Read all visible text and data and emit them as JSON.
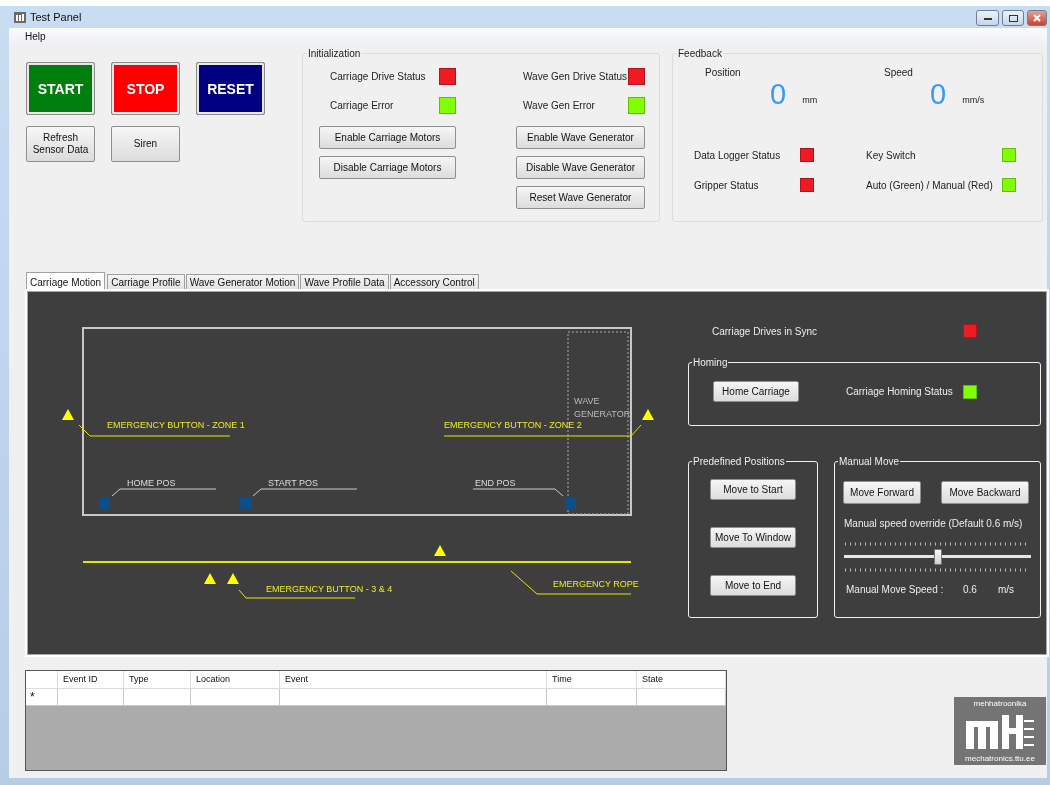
{
  "window": {
    "title": "Test Panel"
  },
  "menu": [
    "Help"
  ],
  "main_buttons": [
    {
      "label": "START",
      "color": "#007f0e"
    },
    {
      "label": "STOP",
      "color": "#ff0000"
    },
    {
      "label": "RESET",
      "color": "#000080"
    }
  ],
  "small_buttons": [
    "Refresh\nSensor Data",
    "Siren"
  ],
  "initialization": {
    "title": "Initialization",
    "columns": [
      {
        "indicators": [
          {
            "label": "Carriage Drive Status",
            "color": "#ed1c24"
          },
          {
            "label": "Carriage Error",
            "color": "#80ff00"
          }
        ],
        "buttons": [
          "Enable Carriage Motors",
          "Disable Carriage Motors"
        ]
      },
      {
        "indicators": [
          {
            "label": "Wave Gen Drive Status",
            "color": "#ed1c24"
          },
          {
            "label": "Wave Gen Error",
            "color": "#80ff00"
          }
        ],
        "buttons": [
          "Enable Wave Generator",
          "Disable Wave Generator",
          "Reset Wave Generator"
        ]
      }
    ]
  },
  "feedback": {
    "title": "Feedback",
    "readings": [
      {
        "label": "Position",
        "value": "0",
        "unit": "mm"
      },
      {
        "label": "Speed",
        "value": "0",
        "unit": "mm/s"
      }
    ],
    "indicators": [
      {
        "label": "Data Logger Status",
        "color": "#ed1c24"
      },
      {
        "label": "Key Switch",
        "color": "#80ff00"
      },
      {
        "label": "Gripper Status",
        "color": "#ed1c24"
      },
      {
        "label": "Auto (Green) / Manual (Red)",
        "color": "#80ff00"
      }
    ]
  },
  "tabs": [
    {
      "label": "Carriage Motion",
      "selected": true
    },
    {
      "label": "Carriage Profile",
      "selected": false
    },
    {
      "label": "Wave Generator Motion",
      "selected": false
    },
    {
      "label": "Wave Profile Data",
      "selected": false
    },
    {
      "label": "Accessory Control",
      "selected": false
    }
  ],
  "diagram": {
    "wave_generator": [
      "WAVE",
      "GENERATOR"
    ],
    "emergency_labels": [
      "EMERGENCY BUTTON - ZONE 1",
      "EMERGENCY BUTTON - ZONE 2",
      "EMERGENCY BUTTON - 3 & 4",
      "EMERGENCY ROPE"
    ],
    "positions": [
      "HOME POS",
      "START POS",
      "END POS"
    ]
  },
  "sync": {
    "label": "Carriage Drives in Sync",
    "color": "#ed1c24"
  },
  "homing": {
    "title": "Homing",
    "button": "Home Carriage",
    "status_label": "Carriage Homing Status",
    "color": "#80ff00"
  },
  "predefined": {
    "title": "Predefined Positions",
    "buttons": [
      "Move to Start",
      "Move To Window",
      "Move to End"
    ]
  },
  "manual_move": {
    "title": "Manual Move",
    "buttons": [
      "Move Forward",
      "Move Backward"
    ],
    "slider_label": "Manual speed override (Default 0.6 m/s)",
    "level": 0.5,
    "speed_label": "Manual Move Speed :",
    "speed_value": "0.6",
    "speed_unit": "m/s"
  },
  "table": {
    "columns": [
      "Event ID",
      "Type",
      "Location",
      "Event",
      "Time",
      "State"
    ],
    "new_row_marker": "*"
  },
  "logo": {
    "top": "mehhatroonika",
    "bottom": "mechatronics.ttu.ee"
  }
}
